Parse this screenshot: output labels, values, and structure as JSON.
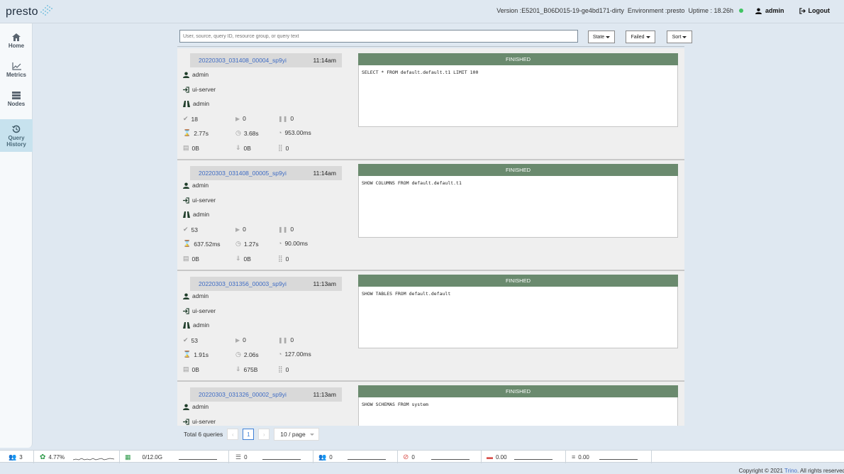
{
  "header": {
    "logo": "presto",
    "version": "Version :E5201_B06D015-19-ge4bd171-dirty",
    "environment": "Environment :presto",
    "uptime": "Uptime : 18.26h",
    "user": "admin",
    "logout": "Logout"
  },
  "nav": {
    "items": [
      {
        "label": "Home",
        "icon": "home-icon"
      },
      {
        "label": "Metrics",
        "icon": "chart-line-icon"
      },
      {
        "label": "Nodes",
        "icon": "server-icon"
      },
      {
        "label1": "Query",
        "label2": "History",
        "icon": "history-icon",
        "active": true
      }
    ]
  },
  "filters": {
    "search_placeholder": "User, source, query ID, resource group, or query text",
    "state_label": "State",
    "failed_label": "Failed",
    "sort_label": "Sort"
  },
  "queries": [
    {
      "id": "20220303_031408_00004_sp9yi",
      "time": "11:14am",
      "user": "admin",
      "source": "ui-server",
      "group": "admin",
      "completed_splits": "18",
      "running_splits": "0",
      "queued_splits": "0",
      "wall_time": "2.77s",
      "elapsed_time": "3.68s",
      "cpu_time": "953.00ms",
      "memory": "0B",
      "input": "0B",
      "output": "0",
      "status": "FINISHED",
      "query": "SELECT * FROM default.default.t1 LIMIT 100"
    },
    {
      "id": "20220303_031408_00005_sp9yi",
      "time": "11:14am",
      "user": "admin",
      "source": "ui-server",
      "group": "admin",
      "completed_splits": "53",
      "running_splits": "0",
      "queued_splits": "0",
      "wall_time": "637.52ms",
      "elapsed_time": "1.27s",
      "cpu_time": "90.00ms",
      "memory": "0B",
      "input": "0B",
      "output": "0",
      "status": "FINISHED",
      "query": "SHOW COLUMNS FROM default.default.t1"
    },
    {
      "id": "20220303_031356_00003_sp9yi",
      "time": "11:13am",
      "user": "admin",
      "source": "ui-server",
      "group": "admin",
      "completed_splits": "53",
      "running_splits": "0",
      "queued_splits": "0",
      "wall_time": "1.91s",
      "elapsed_time": "2.06s",
      "cpu_time": "127.00ms",
      "memory": "0B",
      "input": "675B",
      "output": "0",
      "status": "FINISHED",
      "query": "SHOW TABLES FROM default.default"
    },
    {
      "id": "20220303_031326_00002_sp9yi",
      "time": "11:13am",
      "user": "admin",
      "source": "ui-server",
      "group": "",
      "completed_splits": "",
      "running_splits": "",
      "queued_splits": "",
      "wall_time": "",
      "elapsed_time": "",
      "cpu_time": "",
      "memory": "",
      "input": "",
      "output": "",
      "status": "FINISHED",
      "query": "SHOW SCHEMAS FROM system"
    }
  ],
  "pagination": {
    "total": "Total 6 queries",
    "current_page": "1",
    "page_size": "10 / page"
  },
  "footer": {
    "workers": "3",
    "cpu": "4.77%",
    "memory": "0/12.0G",
    "queued": "0",
    "running": "0",
    "blocked": "0",
    "rate": "0.00",
    "throughput": "0.00",
    "copyright_prefix": "Copyright © 2021",
    "copyright_link": "Trino",
    "copyright_suffix": ". All rights reserved"
  }
}
